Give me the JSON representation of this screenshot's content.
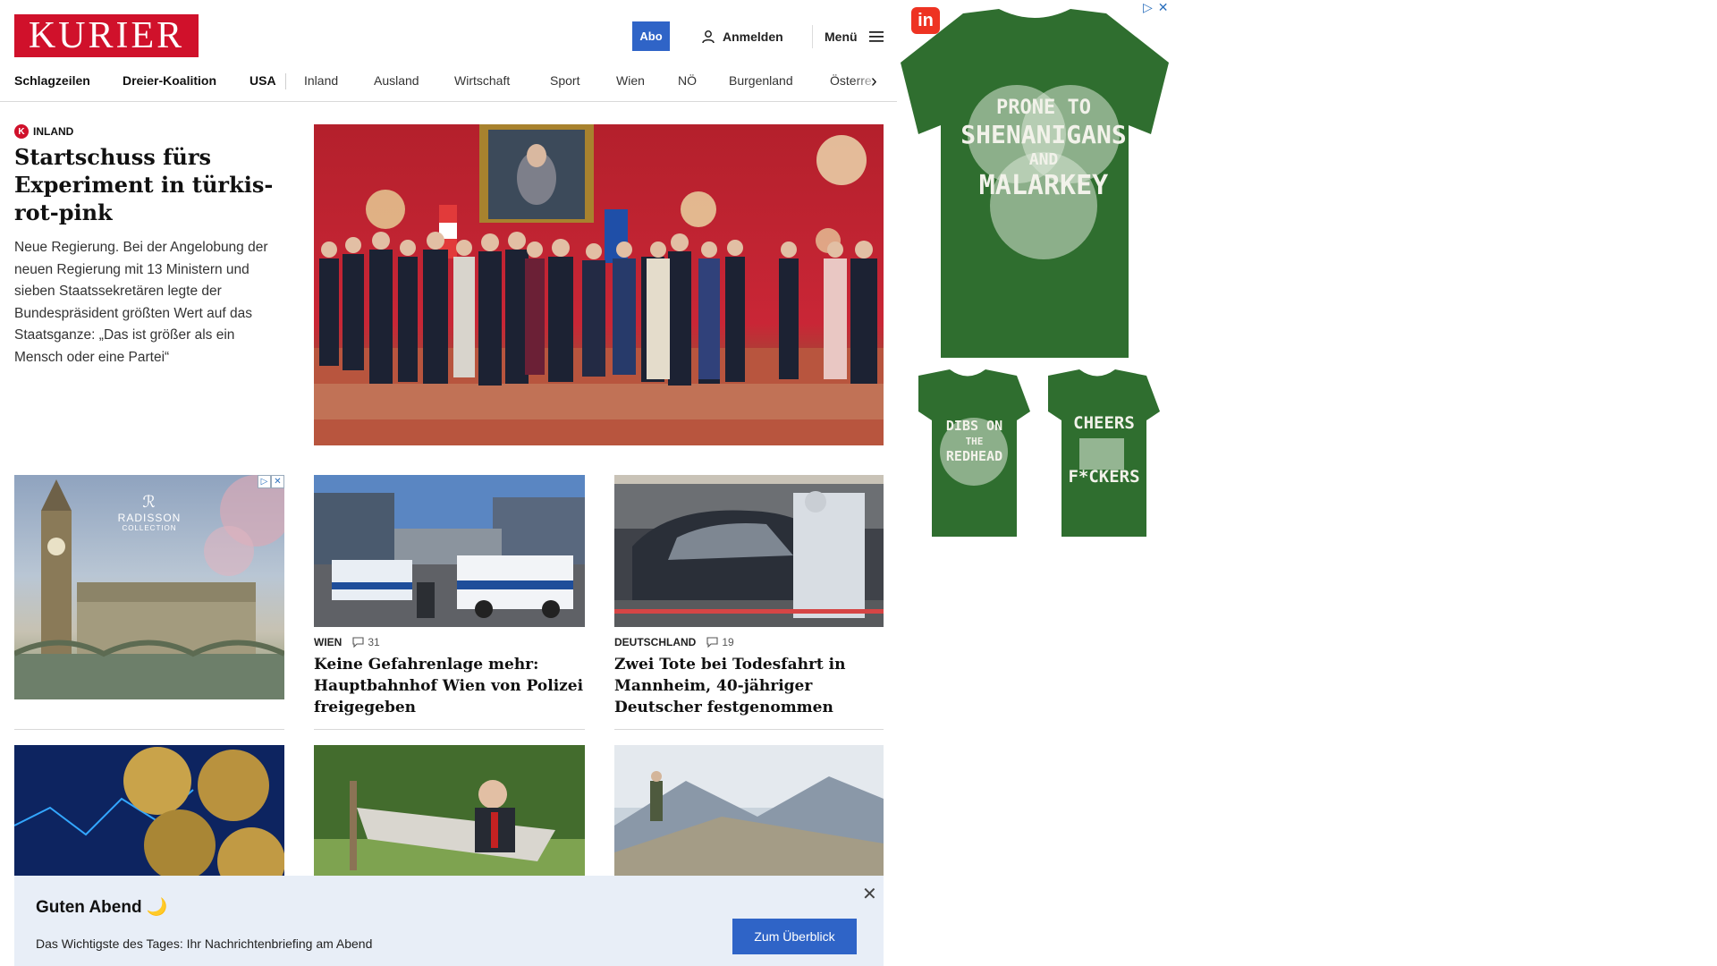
{
  "header": {
    "logo_text": "KURIER",
    "abo_label": "Abo",
    "login_label": "Anmelden",
    "menu_label": "Menü"
  },
  "nav": {
    "items": [
      "Schlagzeilen",
      "Dreier-Koalition",
      "USA",
      "Inland",
      "Ausland",
      "Wirtschaft",
      "Sport",
      "Wien",
      "NÖ",
      "Burgenland",
      "Österre"
    ]
  },
  "lead": {
    "category": "INLAND",
    "title": "Startschuss fürs Experiment in türkis-rot-pink",
    "teaser": "Neue Regierung. Bei der Angelobung der neuen Regierung mit 13 Ministern und sieben Staatssekretären legte der Bundespräsident größten Wert auf das Staatsganze: „Das ist größer als ein Mensch oder eine Partei“"
  },
  "ad_left": {
    "brand": "RADISSON",
    "sub": "COLLECTION"
  },
  "articles": [
    {
      "category": "WIEN",
      "comments": "31",
      "title": "Keine Gefahrenlage mehr: Hauptbahnhof Wien von Polizei freigegeben"
    },
    {
      "category": "DEUTSCHLAND",
      "comments": "19",
      "title": "Zwei Tote bei Todesfahrt in Mannheim, 40-jähriger Deutscher festgenommen"
    }
  ],
  "ad_right": {
    "shirt1_lines": [
      "PRONE TO",
      "SHENANIGANS",
      "AND",
      "MALARKEY"
    ],
    "shirt2_lines": [
      "DIBS ON",
      "THE",
      "REDHEAD"
    ],
    "shirt3_lines": [
      "CHEERS",
      "F*CKERS"
    ]
  },
  "briefing": {
    "title": "Guten Abend 🌙",
    "text": "Das Wichtigste des Tages: Ihr Nachrichtenbriefing am Abend",
    "button": "Zum Überblick"
  },
  "colors": {
    "brand_red": "#d0112b",
    "button_blue": "#2f64c7",
    "briefing_bg": "#e8eef7",
    "shirt_green": "#2f6e2f"
  }
}
